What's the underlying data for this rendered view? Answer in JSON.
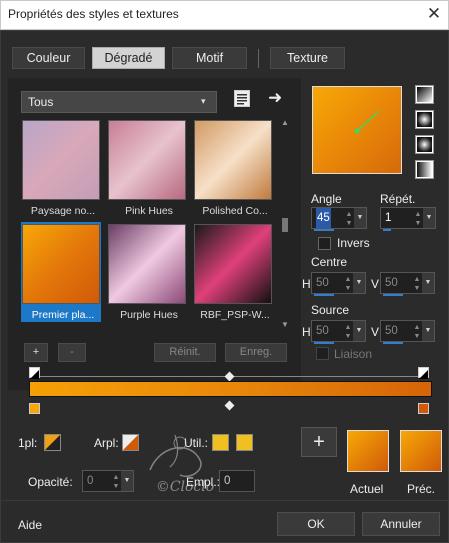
{
  "window": {
    "title": "Propriétés des styles et textures",
    "close": "✕"
  },
  "tabs": [
    {
      "label": "Couleur"
    },
    {
      "label": "Dégradé"
    },
    {
      "label": "Motif"
    },
    {
      "label": "Texture"
    }
  ],
  "dropdown": {
    "value": "Tous",
    "arrow": "▾"
  },
  "presets": [
    {
      "label": "Paysage no...",
      "colors": [
        "#b9a6c9",
        "#d9a8b9",
        "#c29db6"
      ]
    },
    {
      "label": "Pink Hues",
      "colors": [
        "#c87e96",
        "#e7c3cd",
        "#b8687f"
      ]
    },
    {
      "label": "Polished Co...",
      "colors": [
        "#d29a63",
        "#f6e0c8",
        "#c07a3c"
      ]
    },
    {
      "label": "Premier pla...",
      "colors": [
        "#f7a808",
        "#e4780a",
        "#d05a08"
      ]
    },
    {
      "label": "Purple Hues",
      "colors": [
        "#6b3e66",
        "#f0c9e0",
        "#8c4a7a"
      ]
    },
    {
      "label": "RBF_PSP-W...",
      "colors": [
        "#1a1a1a",
        "#e0407a",
        "#111111"
      ]
    }
  ],
  "buttons": {
    "add": "+",
    "remove": "-",
    "reset": "Réinit.",
    "save": "Enreg."
  },
  "angle": {
    "label": "Angle",
    "value": "45"
  },
  "repeat": {
    "label": "Répét.",
    "value": "1"
  },
  "invert": {
    "label": "Invers"
  },
  "center": {
    "label": "Centre",
    "h_label": "H",
    "h_value": "50",
    "v_label": "V",
    "v_value": "50"
  },
  "source": {
    "label": "Source",
    "h_label": "H",
    "h_value": "50",
    "v_label": "V",
    "v_value": "50"
  },
  "link": {
    "label": "Liaison"
  },
  "opacity": {
    "label": "Opacité:",
    "value": "0"
  },
  "stops": {
    "first_label": "1pl:",
    "arpl_label": "Arpl:",
    "util_label": "Util.:",
    "empl_label": "Empl.:",
    "empl_value": "0",
    "util_color1": "#f0c020",
    "util_color2": "#f0c020"
  },
  "swatches": {
    "current_label": "Actuel",
    "previous_label": "Préc.",
    "current_color": "#e88a0a",
    "previous_color": "#e88a0a"
  },
  "footer": {
    "help": "Aide",
    "ok": "OK",
    "cancel": "Annuler"
  },
  "watermark_text": "©Cloclo",
  "colors": {
    "accent": "#1e78c8",
    "gradient_start": "#f7a808",
    "gradient_end": "#d05a08"
  }
}
